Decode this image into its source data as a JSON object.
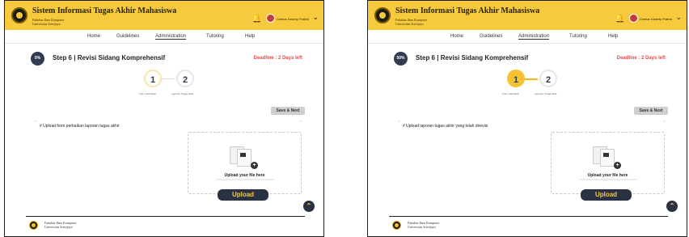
{
  "colors": {
    "accent": "#f7ca3e",
    "dark": "#2a3142",
    "deadline": "#e54b4b",
    "progress": "#2f3c4f"
  },
  "panels": [
    {
      "app_title": "Sistem Informasi Tugas Akhir Mahasiswa",
      "institution_line1": "Fakultas Ilmu Komputer",
      "institution_line2": "Universitas Sriwijaya",
      "user_name": "Clarisa Julianty Pratiwi",
      "nav": [
        "Home",
        "Guidelines",
        "Administration",
        "Tutoring",
        "Help"
      ],
      "active_nav": "Administration",
      "progress_label": "0%",
      "progress_value": 0,
      "step_title": "Step 6 | Revisi Sidang Komprehensif",
      "deadline": "Deadline : 2 Days left",
      "step1_number": "1",
      "step2_number": "2",
      "step1_label": "Form Perbaikan",
      "step2_label": "Laporan Tugas Akhir",
      "save_button": "Save & Next",
      "instruction": "# Upload form perbaikan laporan tugas akhir",
      "upload_prompt": "Upload your file here",
      "upload_button": "Upload",
      "footer_line1": "Fakultas Ilmu Komputer",
      "footer_line2": "Universitas Sriwijaya"
    },
    {
      "app_title": "Sistem Informasi Tugas Akhir Mahasiswa",
      "institution_line1": "Fakultas Ilmu Komputer",
      "institution_line2": "Universitas Sriwijaya",
      "user_name": "Clarisa Julianty Pratiwi",
      "nav": [
        "Home",
        "Guidelines",
        "Administration",
        "Tutoring",
        "Help"
      ],
      "active_nav": "Administration",
      "progress_label": "50%",
      "progress_value": 50,
      "step_title": "Step 6 | Revisi Sidang Komprehensif",
      "deadline": "Deadline : 2 Days left",
      "step1_number": "1",
      "step2_number": "2",
      "step1_label": "Form Perbaikan",
      "step2_label": "Laporan Tugas Akhir",
      "save_button": "Save & Next",
      "instruction": "# Upload laporan tugas akhir yang telah direvisi",
      "upload_prompt": "Upload your file here",
      "upload_button": "Upload",
      "footer_line1": "Fakultas Ilmu Komputer",
      "footer_line2": "Universitas Sriwijaya"
    }
  ]
}
